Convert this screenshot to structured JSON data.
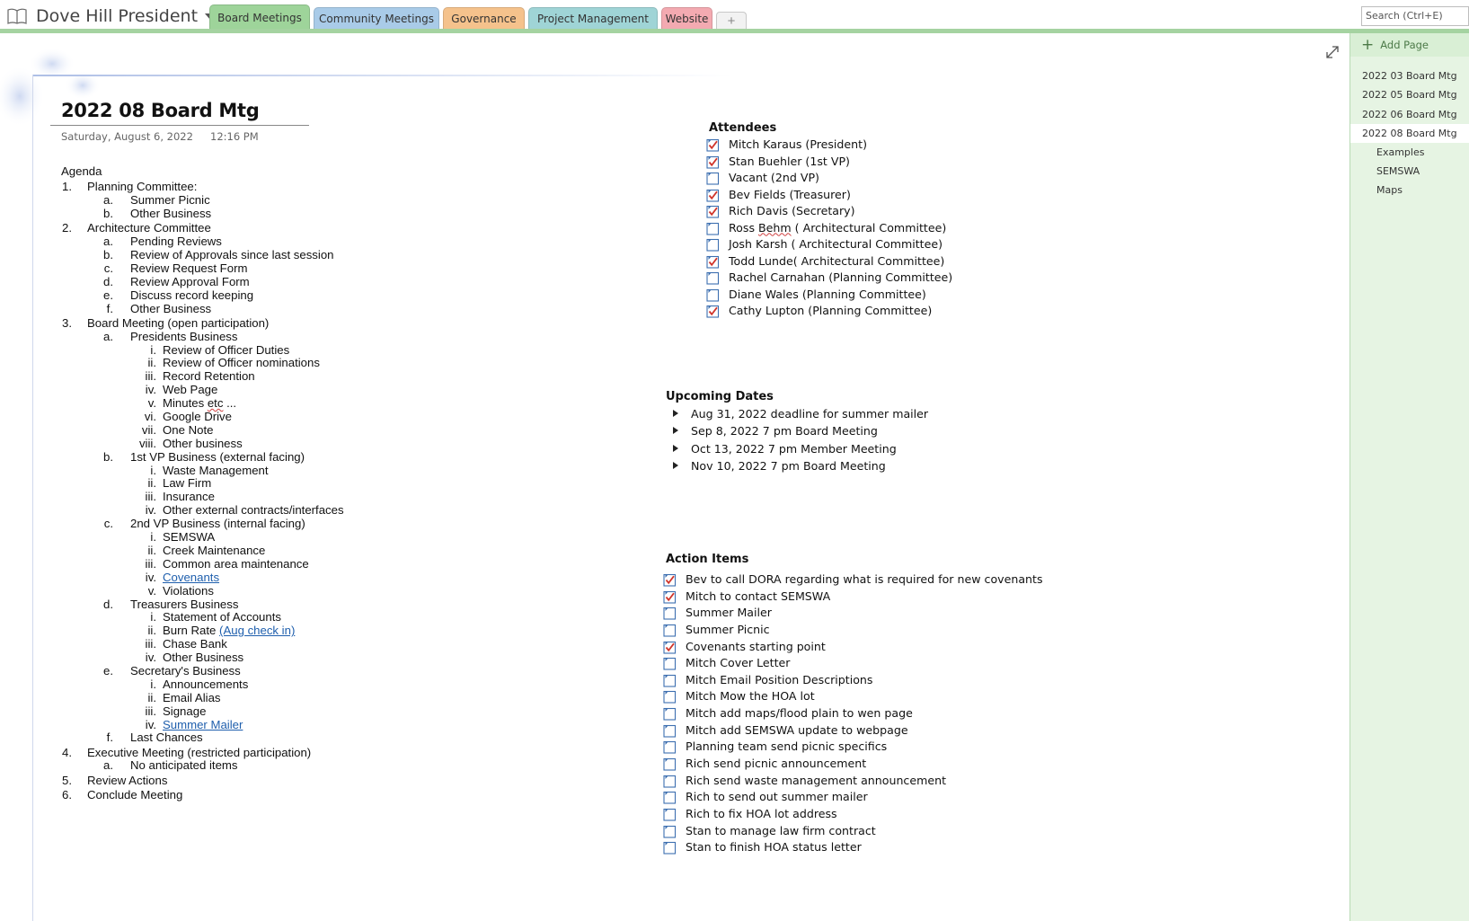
{
  "notebook": {
    "title": "Dove Hill President"
  },
  "tabs": [
    {
      "label": "Board Meetings",
      "color": "#9ed49a",
      "active": true
    },
    {
      "label": "Community Meetings",
      "color": "#a9cbe8",
      "active": false
    },
    {
      "label": "Governance",
      "color": "#f5c28c",
      "active": false
    },
    {
      "label": "Project Management",
      "color": "#9fd4d6",
      "active": false
    },
    {
      "label": "Website",
      "color": "#f3aab1",
      "active": false
    }
  ],
  "add_tab_label": "+",
  "search": {
    "placeholder": "Search (Ctrl+E)"
  },
  "page": {
    "title": "2022 08 Board Mtg",
    "date": "Saturday, August 6, 2022",
    "time": "12:16 PM"
  },
  "agenda": {
    "heading": "Agenda",
    "items": [
      {
        "num": "1.",
        "text": "Planning Committee:",
        "sub": [
          {
            "num": "a.",
            "text": "Summer Picnic"
          },
          {
            "num": "b.",
            "text": "Other Business"
          }
        ]
      },
      {
        "num": "2.",
        "text": "Architecture Committee",
        "sub": [
          {
            "num": "a.",
            "text": "Pending Reviews"
          },
          {
            "num": "b.",
            "text": "Review of Approvals since last session"
          },
          {
            "num": "c.",
            "text": "Review Request Form"
          },
          {
            "num": "d.",
            "text": "Review Approval Form"
          },
          {
            "num": "e.",
            "text": "Discuss record keeping"
          },
          {
            "num": "f.",
            "text": "Other Business"
          }
        ]
      },
      {
        "num": "3.",
        "text": "Board Meeting (open participation)",
        "sub": [
          {
            "num": "a.",
            "text": "Presidents Business",
            "sub": [
              {
                "num": "i.",
                "text": "Review of Officer Duties"
              },
              {
                "num": "ii.",
                "text": "Review of Officer nominations"
              },
              {
                "num": "iii.",
                "text": "Record Retention"
              },
              {
                "num": "iv.",
                "text": "Web Page"
              },
              {
                "num": "v.",
                "text": "Minutes etc ..."
              },
              {
                "num": "vi.",
                "text": "Google Drive"
              },
              {
                "num": "vii.",
                "text": "One Note"
              },
              {
                "num": "viii.",
                "text": "Other business"
              }
            ]
          },
          {
            "num": "b.",
            "text": "1st VP Business (external facing)",
            "sub": [
              {
                "num": "i.",
                "text": "Waste Management"
              },
              {
                "num": "ii.",
                "text": "Law Firm"
              },
              {
                "num": "iii.",
                "text": "Insurance"
              },
              {
                "num": "iv.",
                "text": "Other external contracts/interfaces"
              }
            ]
          },
          {
            "num": "c.",
            "text": "2nd VP Business (internal facing)",
            "sub": [
              {
                "num": "i.",
                "text": "SEMSWA"
              },
              {
                "num": "ii.",
                "text": "Creek Maintenance"
              },
              {
                "num": "iii.",
                "text": "Common area maintenance"
              },
              {
                "num": "iv.",
                "text": "Covenants",
                "link": true
              },
              {
                "num": "v.",
                "text": "Violations"
              }
            ]
          },
          {
            "num": "d.",
            "text": "Treasurers Business",
            "sub": [
              {
                "num": "i.",
                "text": "Statement of Accounts"
              },
              {
                "num": "ii.",
                "text": "Burn Rate ",
                "link_suffix": "(Aug check in)"
              },
              {
                "num": "iii.",
                "text": "Chase Bank"
              },
              {
                "num": "iv.",
                "text": "Other Business"
              }
            ]
          },
          {
            "num": "e.",
            "text": "Secretary's Business",
            "sub": [
              {
                "num": "i.",
                "text": "Announcements"
              },
              {
                "num": "ii.",
                "text": "Email Alias"
              },
              {
                "num": "iii.",
                "text": "Signage"
              },
              {
                "num": "iv.",
                "text": "Summer Mailer",
                "link": true
              }
            ]
          },
          {
            "num": "f.",
            "text": "Last Chances"
          }
        ]
      },
      {
        "num": "4.",
        "text": "Executive Meeting (restricted participation)",
        "sub": [
          {
            "num": "a.",
            "text": "No anticipated items"
          }
        ]
      },
      {
        "num": "5.",
        "text": "Review Actions"
      },
      {
        "num": "6.",
        "text": "Conclude Meeting"
      }
    ]
  },
  "attendees": {
    "title": "Attendees",
    "items": [
      {
        "label": "Mitch Karaus (President)",
        "checked": true
      },
      {
        "label": "Stan Buehler (1st VP)",
        "checked": true
      },
      {
        "label": "Vacant (2nd VP)",
        "checked": false
      },
      {
        "label": "Bev Fields (Treasurer)",
        "checked": true
      },
      {
        "label": "Rich Davis (Secretary)",
        "checked": true
      },
      {
        "label": "Ross Behm ( Architectural Committee)",
        "checked": false
      },
      {
        "label": "Josh Karsh ( Architectural Committee)",
        "checked": false
      },
      {
        "label": "Todd Lunde( Architectural Committee)",
        "checked": true
      },
      {
        "label": "Rachel Carnahan (Planning Committee)",
        "checked": false
      },
      {
        "label": "Diane Wales (Planning Committee)",
        "checked": false
      },
      {
        "label": "Cathy Lupton (Planning Committee)",
        "checked": true
      }
    ]
  },
  "upcoming": {
    "title": "Upcoming Dates",
    "items": [
      "Aug 31, 2022 deadline for summer mailer",
      "Sep 8, 2022 7 pm Board Meeting",
      "Oct 13, 2022 7 pm Member Meeting",
      "Nov 10, 2022 7 pm Board Meeting"
    ]
  },
  "actions": {
    "title": "Action Items",
    "items": [
      {
        "label": "Bev to call DORA regarding what is required for new covenants",
        "checked": true
      },
      {
        "label": "Mitch to contact SEMSWA",
        "checked": true
      },
      {
        "label": "Summer Mailer",
        "checked": false
      },
      {
        "label": "Summer Picnic",
        "checked": false
      },
      {
        "label": "Covenants starting point",
        "checked": true
      },
      {
        "label": "Mitch Cover Letter",
        "checked": false
      },
      {
        "label": "Mitch Email Position Descriptions",
        "checked": false
      },
      {
        "label": "Mitch Mow the HOA lot",
        "checked": false
      },
      {
        "label": "Mitch add maps/flood plain to wen page",
        "checked": false
      },
      {
        "label": "Mitch add SEMSWA update to webpage",
        "checked": false
      },
      {
        "label": "Planning team send picnic specifics",
        "checked": false
      },
      {
        "label": "Rich send picnic announcement",
        "checked": false
      },
      {
        "label": "Rich send waste management announcement",
        "checked": false
      },
      {
        "label": "Rich to send out summer mailer",
        "checked": false
      },
      {
        "label": "Rich to fix HOA lot address",
        "checked": false
      },
      {
        "label": "Stan to manage law firm contract",
        "checked": false
      },
      {
        "label": "Stan to finish HOA status letter",
        "checked": false
      }
    ]
  },
  "sidebar": {
    "add_page": "Add Page",
    "pages": [
      {
        "label": "2022 03 Board Mtg",
        "level": 0,
        "selected": false
      },
      {
        "label": "2022 05 Board Mtg",
        "level": 0,
        "selected": false
      },
      {
        "label": "2022 06 Board Mtg",
        "level": 0,
        "selected": false
      },
      {
        "label": "2022 08 Board Mtg",
        "level": 0,
        "selected": true
      },
      {
        "label": "Examples",
        "level": 1,
        "selected": false
      },
      {
        "label": "SEMSWA",
        "level": 1,
        "selected": false
      },
      {
        "label": "Maps",
        "level": 1,
        "selected": false
      }
    ]
  },
  "icons": {
    "notebook": "notebook-icon",
    "expand": "expand-icon",
    "add_page": "plus-icon",
    "checkbox": "todo-checkbox-icon",
    "bullet": "triangle-bullet-icon"
  }
}
